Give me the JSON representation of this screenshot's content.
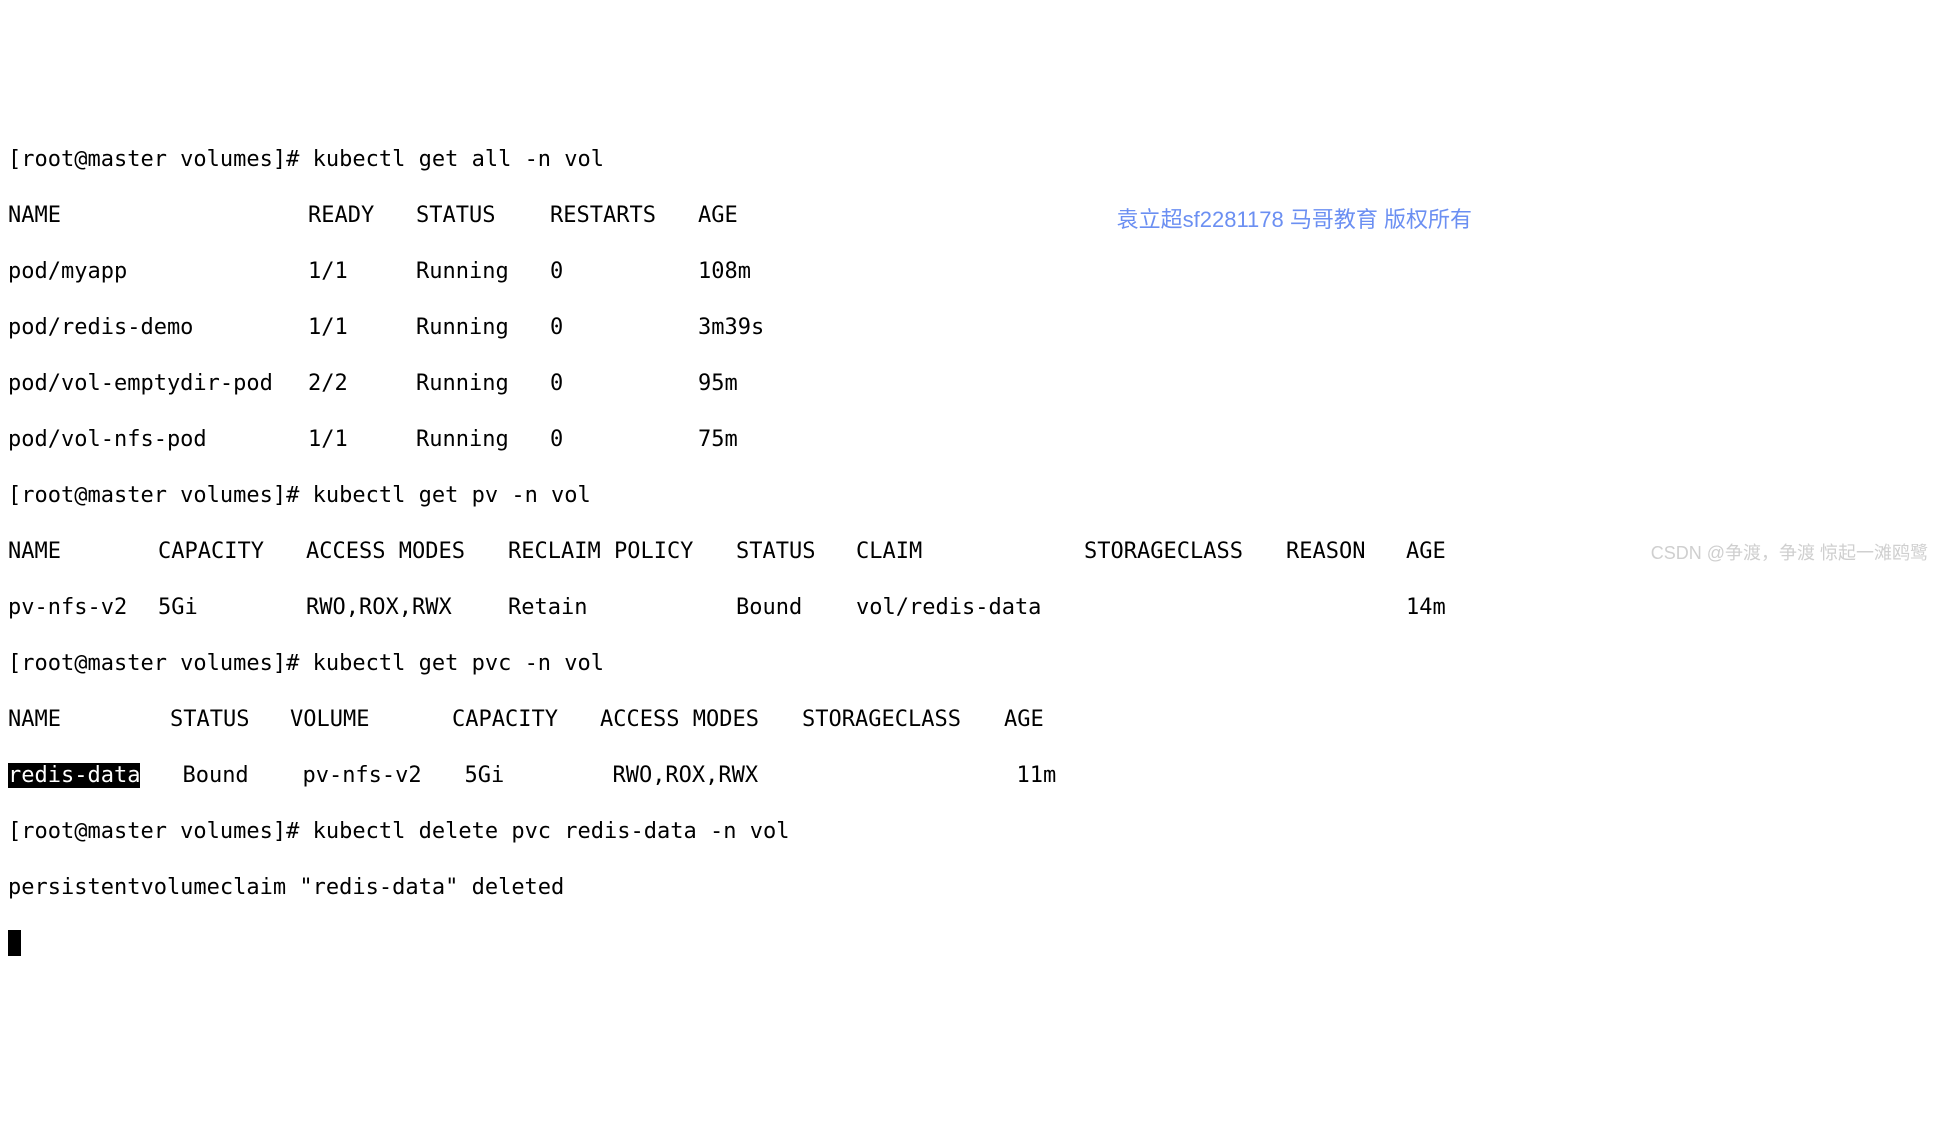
{
  "prompts": {
    "p1": "[root@master volumes]# ",
    "p2": "[root@master volumes]# ",
    "p3": "[root@master volumes]# ",
    "p4": "[root@master volumes]# "
  },
  "commands": {
    "cmd1": "kubectl get all -n vol",
    "cmd2": "kubectl get pv -n vol",
    "cmd3": "kubectl get pvc -n vol",
    "cmd4": "kubectl delete pvc redis-data -n vol"
  },
  "getall": {
    "header": {
      "c1": "NAME",
      "c2": "READY",
      "c3": "STATUS",
      "c4": "RESTARTS",
      "c5": "AGE"
    },
    "rows": [
      {
        "c1": "pod/myapp",
        "c2": "1/1",
        "c3": "Running",
        "c4": "0",
        "c5": "108m"
      },
      {
        "c1": "pod/redis-demo",
        "c2": "1/1",
        "c3": "Running",
        "c4": "0",
        "c5": "3m39s"
      },
      {
        "c1": "pod/vol-emptydir-pod",
        "c2": "2/2",
        "c3": "Running",
        "c4": "0",
        "c5": "95m"
      },
      {
        "c1": "pod/vol-nfs-pod",
        "c2": "1/1",
        "c3": "Running",
        "c4": "0",
        "c5": "75m"
      }
    ]
  },
  "getpv": {
    "header": {
      "c1": "NAME",
      "c2": "CAPACITY",
      "c3": "ACCESS MODES",
      "c4": "RECLAIM POLICY",
      "c5": "STATUS",
      "c6": "CLAIM",
      "c7": "STORAGECLASS",
      "c8": "REASON",
      "c9": "AGE"
    },
    "rows": [
      {
        "c1": "pv-nfs-v2",
        "c2": "5Gi",
        "c3": "RWO,ROX,RWX",
        "c4": "Retain",
        "c5": "Bound",
        "c6": "vol/redis-data",
        "c7": "",
        "c8": "",
        "c9": "14m"
      }
    ]
  },
  "getpvc": {
    "header": {
      "c1": "NAME",
      "c2": "STATUS",
      "c3": "VOLUME",
      "c4": "CAPACITY",
      "c5": "ACCESS MODES",
      "c6": "STORAGECLASS",
      "c7": "AGE"
    },
    "rows": [
      {
        "c1": "redis-data",
        "c2": "Bound",
        "c3": "pv-nfs-v2",
        "c4": "5Gi",
        "c5": "RWO,ROX,RWX",
        "c6": "",
        "c7": "11m"
      }
    ]
  },
  "deleteout": {
    "line": "persistentvolumeclaim \"redis-data\" deleted"
  },
  "watermarks": {
    "w1": "袁立超sf2281178 马哥教育 版权所有",
    "w2": "CSDN @争渡，争渡 惊起一滩鸥鹭"
  }
}
